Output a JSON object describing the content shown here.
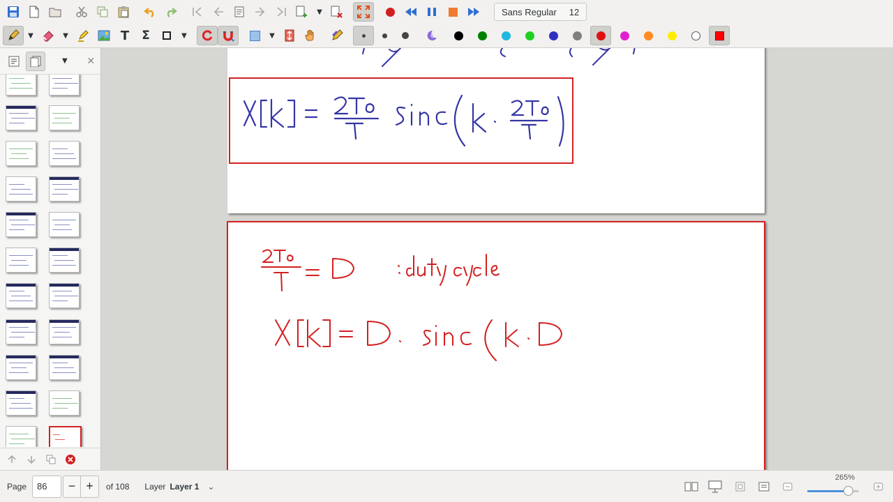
{
  "toolbar": {
    "font_name": "Sans Regular",
    "font_size": "12",
    "pen_colors": [
      "#000000",
      "#008000",
      "#20b8e0",
      "#20d020",
      "#3030c0",
      "#808080",
      "#e01010",
      "#e020d0",
      "#ff8c20",
      "#ffee00",
      "#ffffff",
      "#ff0000"
    ],
    "icons": {
      "row1": [
        "save-icon",
        "new-document-icon",
        "open-folder-icon",
        "cut-icon",
        "copy-icon",
        "paste-icon",
        "undo-icon",
        "redo-icon",
        "first-page-icon",
        "previous-page-icon",
        "goto-page-icon",
        "next-page-icon",
        "last-page-icon",
        "new-page-icon",
        "delete-page-icon",
        "fullscreen-icon",
        "record-icon",
        "rewind-icon",
        "pause-icon",
        "stop-icon",
        "fast-forward-icon"
      ],
      "row2": [
        "pen-icon",
        "eraser-icon",
        "highlighter-icon",
        "image-icon",
        "text-icon",
        "formula-icon",
        "shape-icon",
        "rotation-snapping-icon",
        "grid-snapping-icon",
        "select-rect-icon",
        "vertical-space-icon",
        "hand-icon",
        "default-tool-icon",
        "fine-dot-icon",
        "medium-dot-icon",
        "thick-dot-icon",
        "fill-icon"
      ]
    }
  },
  "sidebar": {
    "selected_page": 86
  },
  "status": {
    "page_label": "Page",
    "page_value": "86",
    "minus": "−",
    "plus": "+",
    "of_label": "of 108",
    "layer_label": "Layer",
    "layer_value": "Layer 1",
    "layer_dropdown": "⌄",
    "zoom_label": "265%",
    "zoom_level": 0.8
  },
  "ink_colors": {
    "blue": "#3535a5",
    "red": "#d32020"
  }
}
